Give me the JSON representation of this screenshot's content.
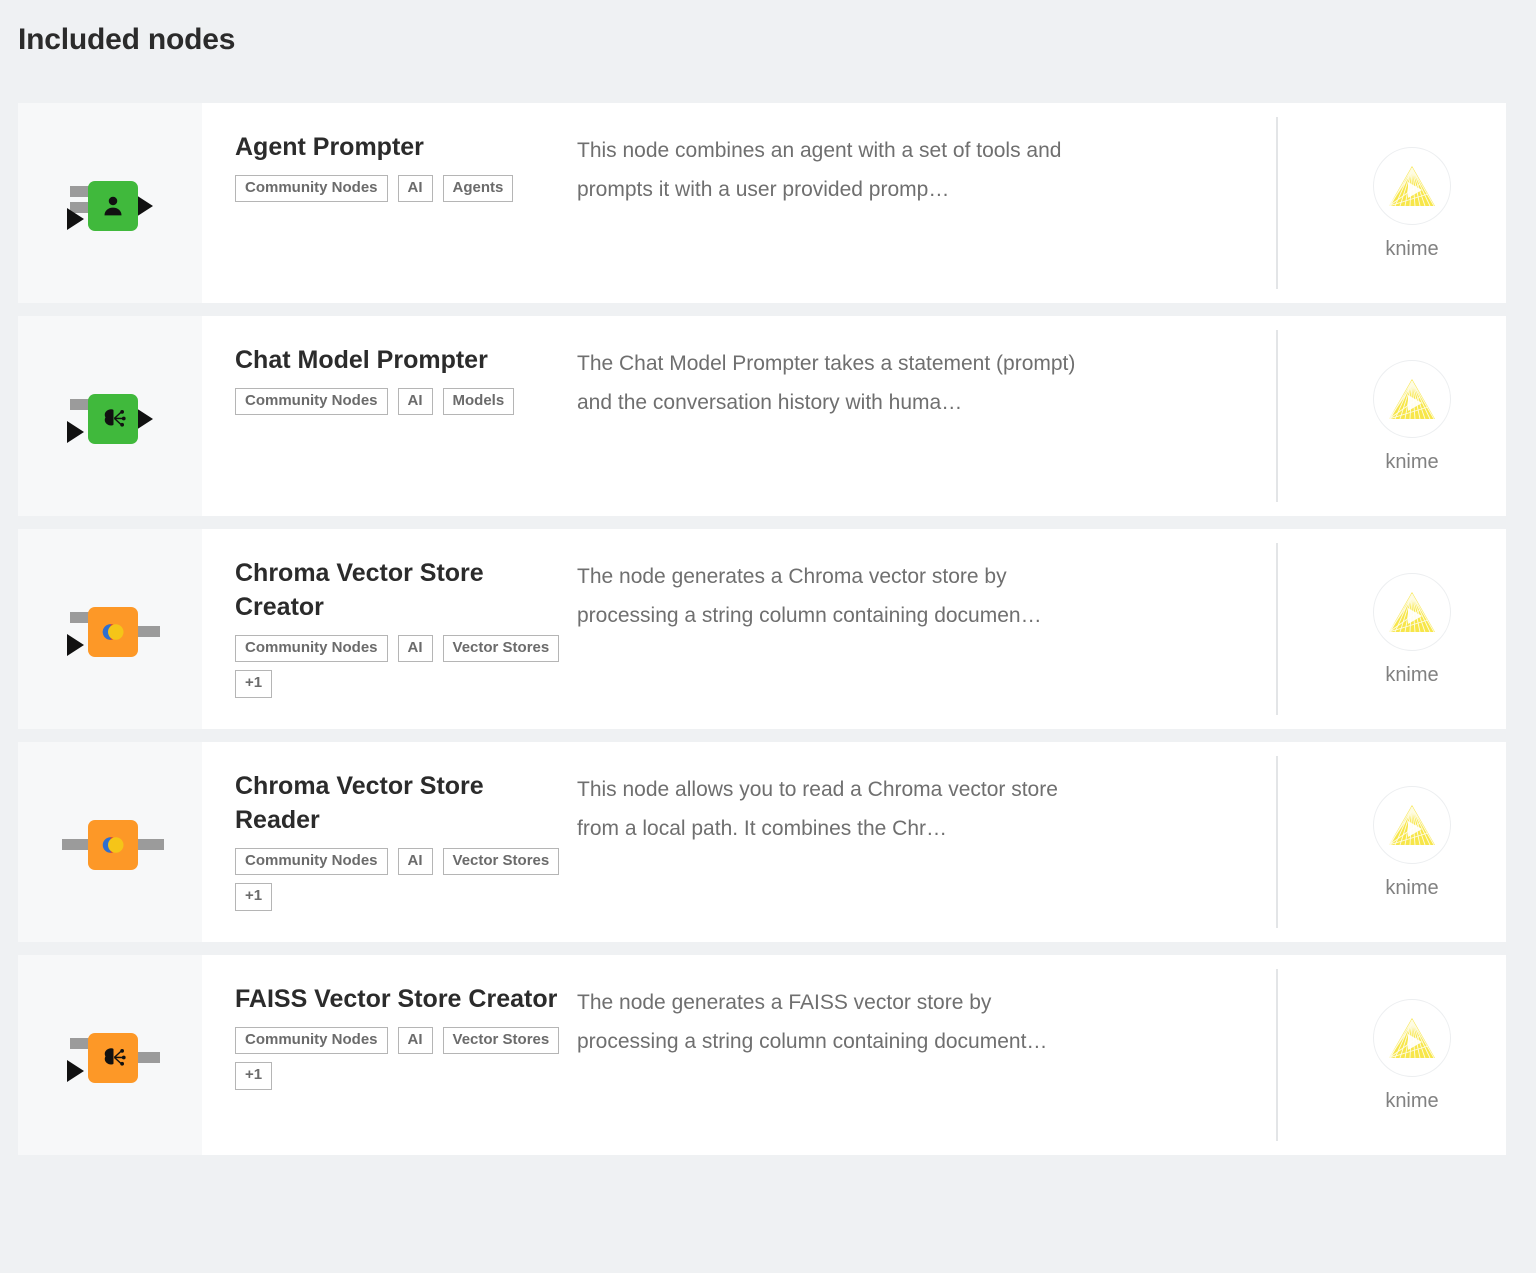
{
  "header": {
    "title": "Included nodes"
  },
  "owner": {
    "name": "knime",
    "logo_icon": "knime-triangle-logo-icon",
    "logo_color": "#f5e02a"
  },
  "colors": {
    "page_background": "#eff1f3",
    "card_background": "#ffffff",
    "icon_panel_background": "#f7f8f9",
    "node_green": "#40b93c",
    "node_orange": "#fd9827",
    "title_text": "#2b2b2b",
    "description_text": "#6f6f6f",
    "tag_border": "#b5b5b5",
    "tag_text": "#6b6b6b"
  },
  "nodes": [
    {
      "name": "Agent Prompter",
      "description": "This node combines an agent with a set of tools and prompts it with a user provided promp…",
      "tags": [
        "Community Nodes",
        "AI",
        "Agents"
      ],
      "icon": {
        "shape_color": "#40b93c",
        "glyph": "person-icon",
        "ports": "two-left-stubs-one-left-triangle-one-right-triangle"
      },
      "owner": "knime"
    },
    {
      "name": "Chat Model Prompter",
      "description": "The Chat Model Prompter takes a statement (prompt) and the conversation history with huma…",
      "tags": [
        "Community Nodes",
        "AI",
        "Models"
      ],
      "icon": {
        "shape_color": "#40b93c",
        "glyph": "ai-brain-circuit-icon",
        "ports": "one-left-stub-one-left-triangle-one-right-triangle"
      },
      "owner": "knime"
    },
    {
      "name": "Chroma Vector Store Creator",
      "description": "The node generates a Chroma vector store by processing a string column containing documen…",
      "tags": [
        "Community Nodes",
        "AI",
        "Vector Stores",
        "+1"
      ],
      "icon": {
        "shape_color": "#fd9827",
        "glyph": "vector-store-circles-icon",
        "ports": "one-left-stub-one-left-triangle-one-right-stub"
      },
      "owner": "knime"
    },
    {
      "name": "Chroma Vector Store Reader",
      "description": "This node allows you to read a Chroma vector store from a local path. It combines the Chr…",
      "tags": [
        "Community Nodes",
        "AI",
        "Vector Stores",
        "+1"
      ],
      "icon": {
        "shape_color": "#fd9827",
        "glyph": "vector-store-circles-icon",
        "ports": "one-left-wide-stub-one-right-wide-stub"
      },
      "owner": "knime"
    },
    {
      "name": "FAISS Vector Store Creator",
      "description": "The node generates a FAISS vector store by processing a string column containing document…",
      "tags": [
        "Community Nodes",
        "AI",
        "Vector Stores",
        "+1"
      ],
      "icon": {
        "shape_color": "#fd9827",
        "glyph": "ai-brain-circuit-icon",
        "ports": "one-left-stub-one-left-triangle-one-right-stub"
      },
      "owner": "knime"
    }
  ]
}
